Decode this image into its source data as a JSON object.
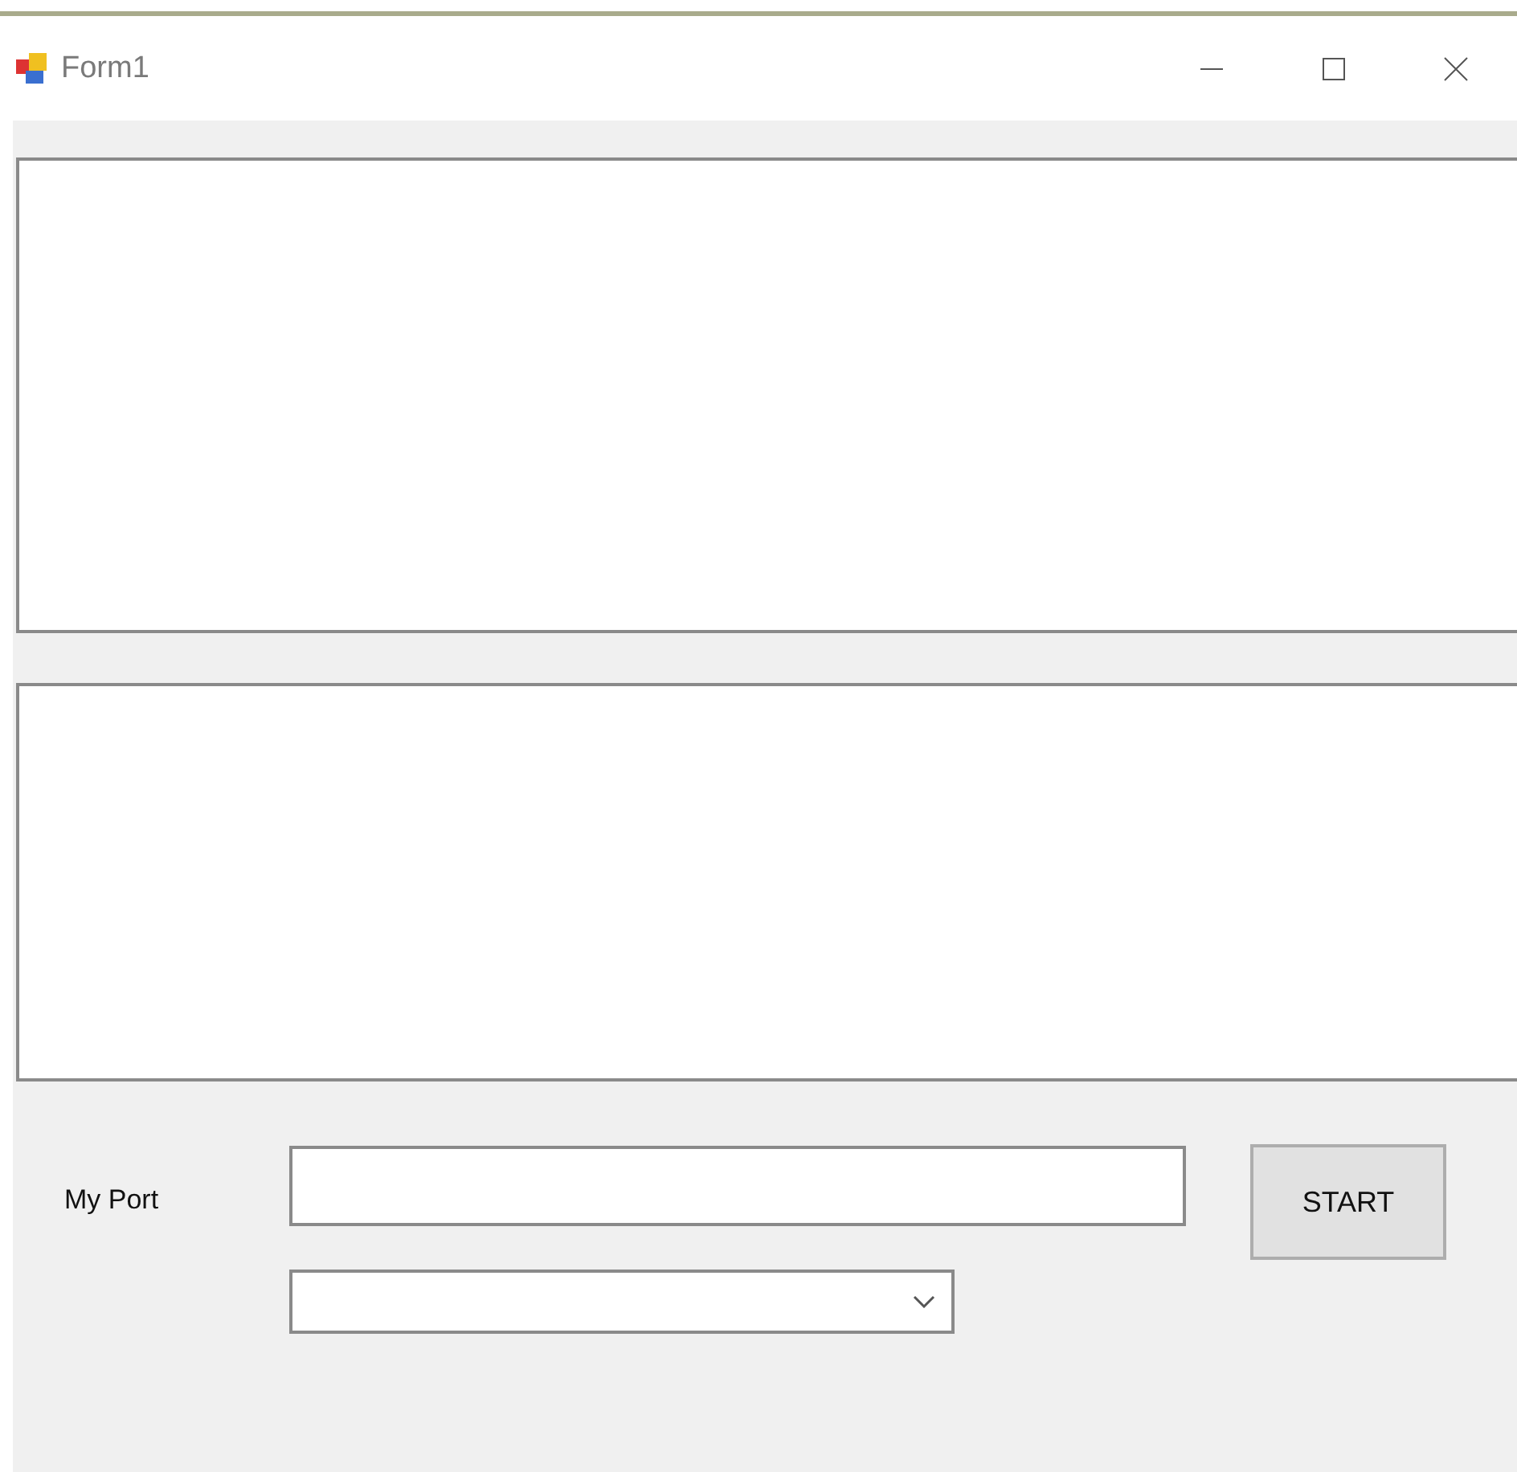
{
  "window": {
    "title": "Form1"
  },
  "port": {
    "label": "My Port"
  },
  "start_button": {
    "label": "START"
  }
}
